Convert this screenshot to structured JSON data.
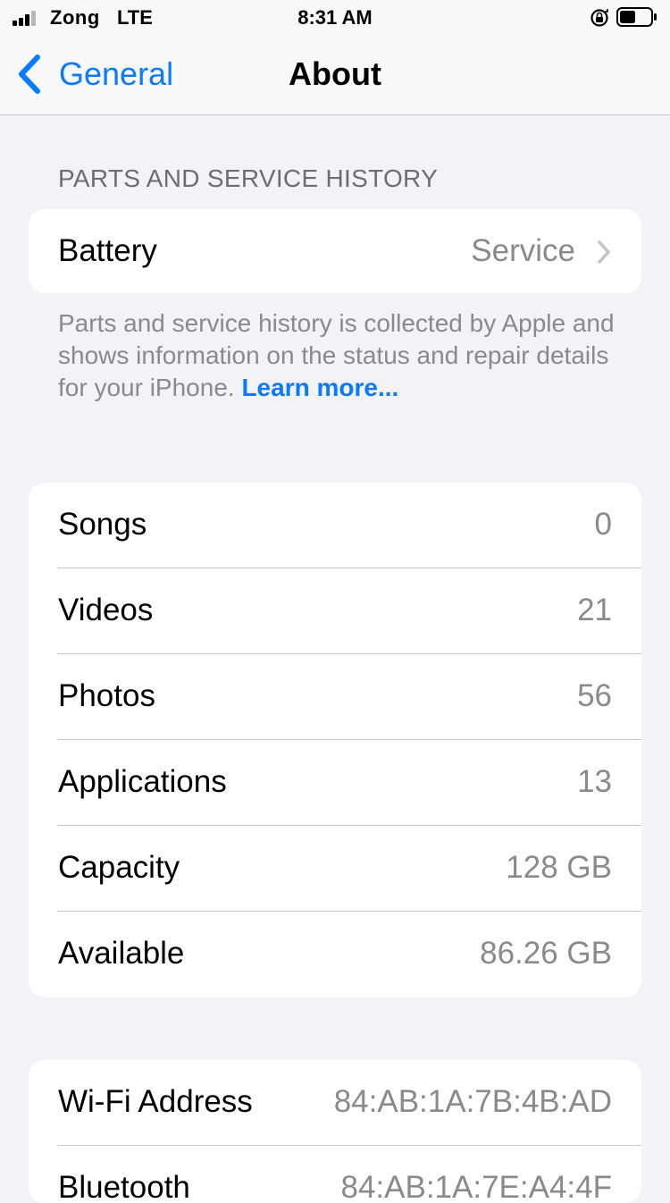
{
  "status_bar": {
    "carrier": "Zong",
    "network": "LTE",
    "time": "8:31 AM"
  },
  "nav": {
    "back_label": "General",
    "title": "About"
  },
  "parts_section": {
    "header": "PARTS AND SERVICE HISTORY",
    "battery_label": "Battery",
    "battery_value": "Service",
    "footer_text": "Parts and service history is collected by Apple and shows information on the status and repair details for your iPhone.",
    "footer_link": "Learn more..."
  },
  "stats": [
    {
      "label": "Songs",
      "value": "0"
    },
    {
      "label": "Videos",
      "value": "21"
    },
    {
      "label": "Photos",
      "value": "56"
    },
    {
      "label": "Applications",
      "value": "13"
    },
    {
      "label": "Capacity",
      "value": "128 GB"
    },
    {
      "label": "Available",
      "value": "86.26 GB"
    }
  ],
  "network_info": [
    {
      "label": "Wi-Fi Address",
      "value": "84:AB:1A:7B:4B:AD"
    },
    {
      "label": "Bluetooth",
      "value": "84:AB:1A:7E:A4:4F"
    }
  ],
  "colors": {
    "accent": "#0a7aff",
    "background": "#f2f2f7",
    "secondary_text": "#8a8a8e"
  }
}
